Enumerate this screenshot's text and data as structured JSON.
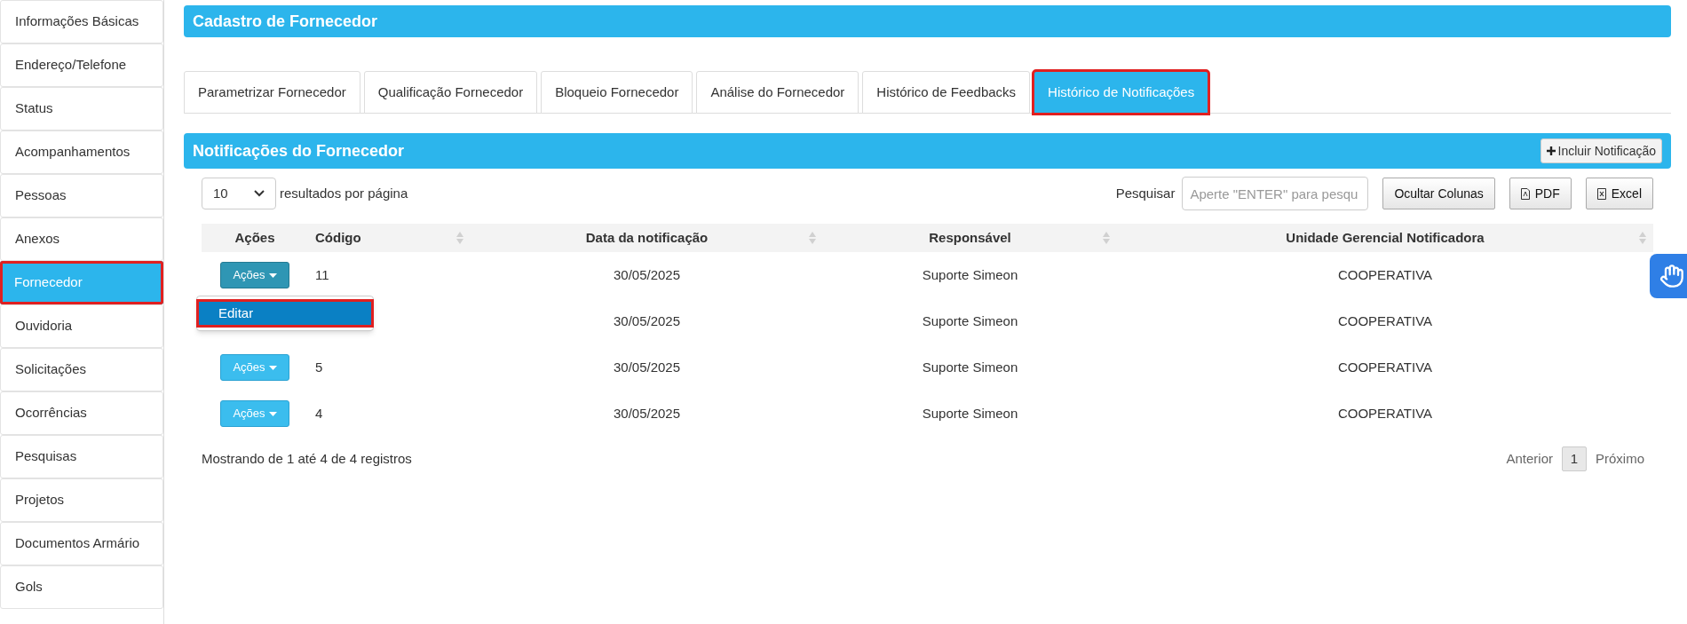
{
  "sidebar": {
    "items": [
      {
        "label": "Informações Básicas",
        "selected": false,
        "highlighted": false
      },
      {
        "label": "Endereço/Telefone",
        "selected": false,
        "highlighted": false
      },
      {
        "label": "Status",
        "selected": false,
        "highlighted": false
      },
      {
        "label": "Acompanhamentos",
        "selected": false,
        "highlighted": false
      },
      {
        "label": "Pessoas",
        "selected": false,
        "highlighted": false
      },
      {
        "label": "Anexos",
        "selected": false,
        "highlighted": false
      },
      {
        "label": "Fornecedor",
        "selected": true,
        "highlighted": true
      },
      {
        "label": "Ouvidoria",
        "selected": false,
        "highlighted": false
      },
      {
        "label": "Solicitações",
        "selected": false,
        "highlighted": false
      },
      {
        "label": "Ocorrências",
        "selected": false,
        "highlighted": false
      },
      {
        "label": "Pesquisas",
        "selected": false,
        "highlighted": false
      },
      {
        "label": "Projetos",
        "selected": false,
        "highlighted": false
      },
      {
        "label": "Documentos Armário",
        "selected": false,
        "highlighted": false
      },
      {
        "label": "Gols",
        "selected": false,
        "highlighted": false
      }
    ]
  },
  "page_title": "Cadastro de Fornecedor",
  "tabs": [
    {
      "label": "Parametrizar Fornecedor",
      "selected": false,
      "highlighted": false
    },
    {
      "label": "Qualificação Fornecedor",
      "selected": false,
      "highlighted": false
    },
    {
      "label": "Bloqueio Fornecedor",
      "selected": false,
      "highlighted": false
    },
    {
      "label": "Análise do Fornecedor",
      "selected": false,
      "highlighted": false
    },
    {
      "label": "Histórico de Feedbacks",
      "selected": false,
      "highlighted": false
    },
    {
      "label": "Histórico de Notificações",
      "selected": true,
      "highlighted": true
    }
  ],
  "section": {
    "title": "Notificações do Fornecedor",
    "add_button": "Incluir Notificação"
  },
  "controls": {
    "page_size": "10",
    "page_size_label": "resultados por página",
    "search_label": "Pesquisar",
    "search_placeholder": "Aperte \"ENTER\" para pesqu",
    "buttons": [
      {
        "kind": "columns",
        "label": "Ocultar Colunas"
      },
      {
        "kind": "pdf",
        "label": "PDF"
      },
      {
        "kind": "excel",
        "label": "Excel"
      }
    ]
  },
  "table": {
    "columns": [
      "Ações",
      "Código",
      "Data da notificação",
      "Responsável",
      "Unidade Gerencial Notificadora"
    ],
    "rows": [
      {
        "actions": "Ações",
        "open": true,
        "code": "11",
        "date": "30/05/2025",
        "responsible": "Suporte Simeon",
        "unit": "COOPERATIVA"
      },
      {
        "date": "30/05/2025",
        "responsible": "Suporte Simeon",
        "unit": "COOPERATIVA"
      },
      {
        "actions": "Ações",
        "open": false,
        "code": "5",
        "date": "30/05/2025",
        "responsible": "Suporte Simeon",
        "unit": "COOPERATIVA"
      },
      {
        "actions": "Ações",
        "open": false,
        "code": "4",
        "date": "30/05/2025",
        "responsible": "Suporte Simeon",
        "unit": "COOPERATIVA"
      }
    ]
  },
  "actions_menu": {
    "items": [
      {
        "label": "Editar",
        "highlighted": true
      }
    ]
  },
  "footer": {
    "info": "Mostrando de 1 até 4 de 4 registros",
    "previous": "Anterior",
    "pages": [
      {
        "label": "1",
        "selected": true
      }
    ],
    "next": "Próximo"
  }
}
